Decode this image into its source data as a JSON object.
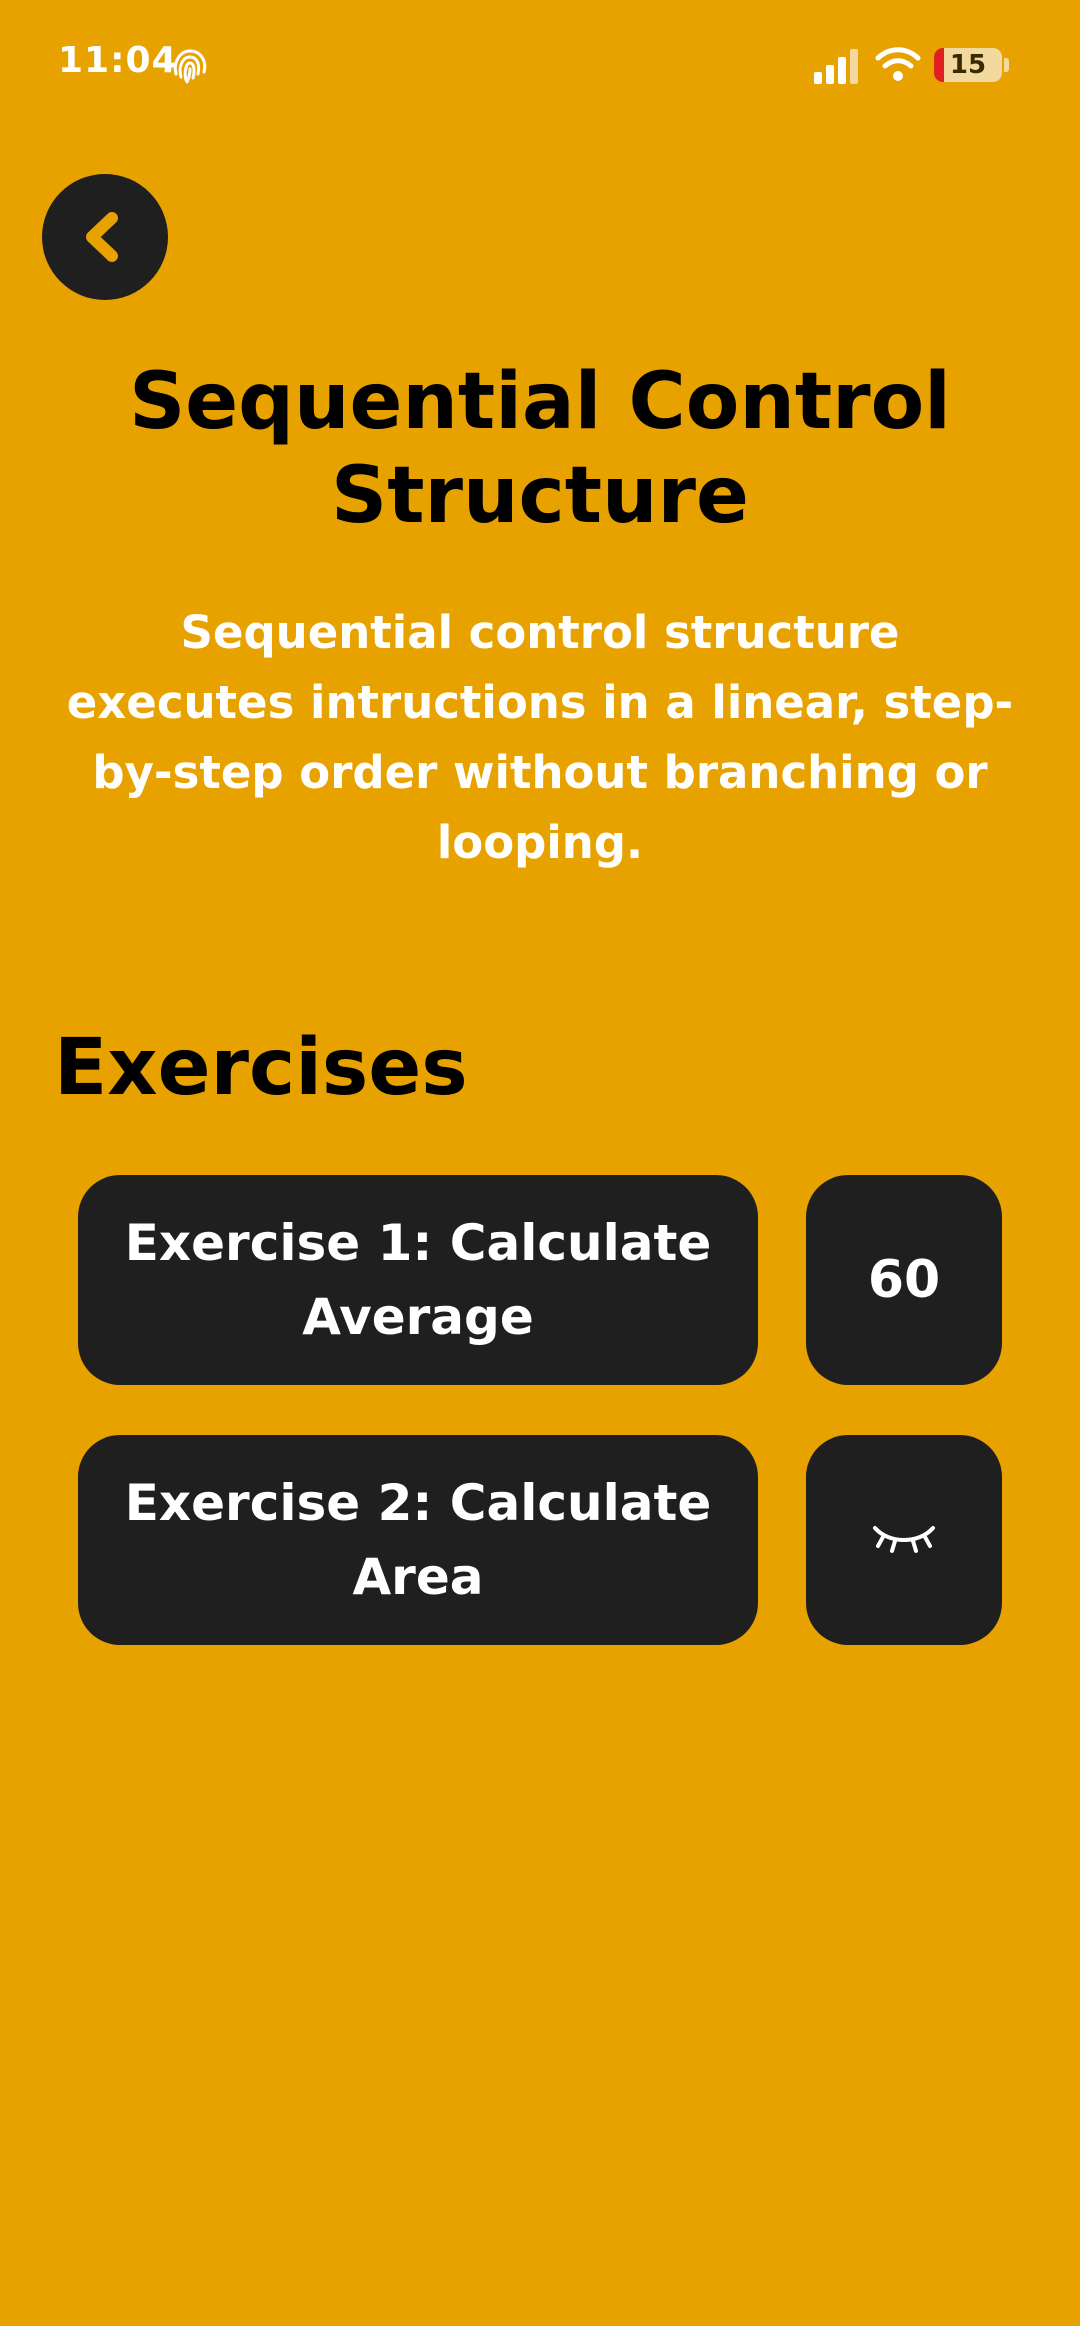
{
  "status_bar": {
    "time": "11:04",
    "battery_level": "15",
    "icons": [
      "fingerprint-icon",
      "signal-icon",
      "wifi-icon",
      "battery-icon"
    ]
  },
  "header": {
    "back_icon": "chevron-left-icon"
  },
  "lesson": {
    "title": "Sequential Control Structure",
    "description": "Sequential control structure executes intructions in a linear, step-by-step order without branching or looping."
  },
  "exercises": {
    "heading": "Exercises",
    "items": [
      {
        "label": "Exercise 1: Calculate Average",
        "score": "60"
      },
      {
        "label": "Exercise 2: Calculate Area",
        "status_icon": "eye-closed-icon"
      }
    ]
  },
  "colors": {
    "background": "#E8A200",
    "card": "#1F1F1F",
    "accent": "#E8A200",
    "battery_low": "#E02020"
  }
}
